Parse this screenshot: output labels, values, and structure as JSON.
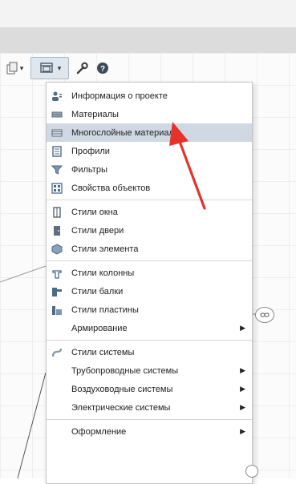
{
  "menu": {
    "items": [
      {
        "label": "Информация о проекте",
        "icon": "project-info-icon"
      },
      {
        "label": "Материалы",
        "icon": "materials-icon"
      },
      {
        "label": "Многослойные материалы",
        "icon": "layered-materials-icon",
        "highlighted": true
      },
      {
        "label": "Профили",
        "icon": "profiles-icon"
      },
      {
        "label": "Фильтры",
        "icon": "filters-icon"
      },
      {
        "label": "Свойства объектов",
        "icon": "object-properties-icon"
      },
      {
        "label": "Стили окна",
        "icon": "window-styles-icon"
      },
      {
        "label": "Стили двери",
        "icon": "door-styles-icon"
      },
      {
        "label": "Стили элемента",
        "icon": "element-styles-icon"
      },
      {
        "label": "Стили колонны",
        "icon": "column-styles-icon"
      },
      {
        "label": "Стили балки",
        "icon": "beam-styles-icon"
      },
      {
        "label": "Стили пластины",
        "icon": "plate-styles-icon"
      },
      {
        "label": "Армирование",
        "submenu": true
      },
      {
        "label": "Стили системы",
        "icon": "system-styles-icon"
      },
      {
        "label": "Трубопроводные системы",
        "submenu": true
      },
      {
        "label": "Воздуховодные системы",
        "submenu": true
      },
      {
        "label": "Электрические системы",
        "submenu": true
      },
      {
        "label": "Оформление",
        "submenu": true
      }
    ]
  },
  "colors": {
    "accent": "#e5332a",
    "highlight": "#cfd8e3"
  }
}
